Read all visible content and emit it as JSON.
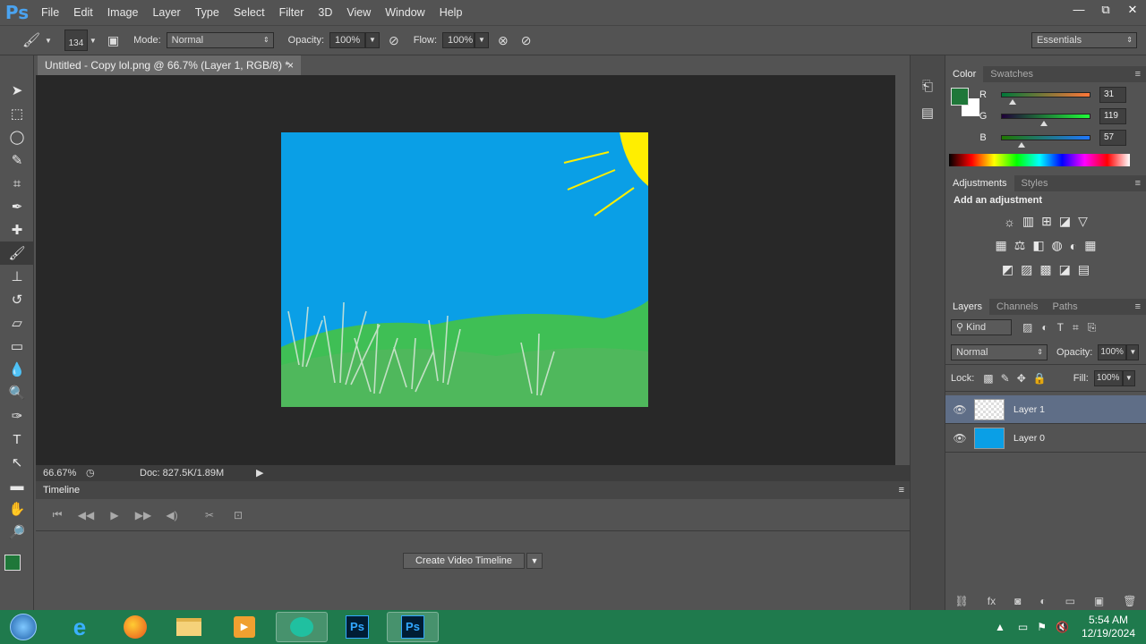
{
  "app": {
    "logo": "Ps"
  },
  "menu": [
    "File",
    "Edit",
    "Image",
    "Layer",
    "Type",
    "Select",
    "Filter",
    "3D",
    "View",
    "Window",
    "Help"
  ],
  "window_controls": {
    "minimize": "—",
    "restore": "⧉",
    "close": "✕"
  },
  "options": {
    "brush_size": "134",
    "mode_label": "Mode:",
    "mode_value": "Normal",
    "opacity_label": "Opacity:",
    "opacity_value": "100%",
    "flow_label": "Flow:",
    "flow_value": "100%",
    "workspace": "Essentials"
  },
  "document": {
    "tab_title": "Untitled - Copy lol.png @ 66.7% (Layer 1, RGB/8) *",
    "tab_close": "×",
    "zoom": "66.67%",
    "doc_info": "Doc: 827.5K/1.89M"
  },
  "timeline": {
    "title": "Timeline",
    "create_button": "Create Video Timeline",
    "controls": [
      "⏮",
      "◀◀",
      "▶",
      "▶▶",
      "◀)",
      "✂",
      "⊡"
    ]
  },
  "color_panel": {
    "tabs": [
      "Color",
      "Swatches"
    ],
    "active_tab": "Color",
    "foreground": "#1f7739",
    "background": "#ffffff",
    "channels": [
      {
        "label": "R",
        "value": "31",
        "fraction": 0.12
      },
      {
        "label": "G",
        "value": "119",
        "fraction": 0.47
      },
      {
        "label": "B",
        "value": "57",
        "fraction": 0.22
      }
    ]
  },
  "adjustments_panel": {
    "tabs": [
      "Adjustments",
      "Styles"
    ],
    "active_tab": "Adjustments",
    "heading": "Add an adjustment",
    "rows": [
      [
        "brightness-contrast-icon",
        "levels-icon",
        "curves-icon",
        "exposure-icon",
        "vibrance-icon"
      ],
      [
        "hue-saturation-icon",
        "color-balance-icon",
        "black-white-icon",
        "photo-filter-icon",
        "channel-mixer-icon",
        "color-lookup-icon"
      ],
      [
        "invert-icon",
        "posterize-icon",
        "threshold-icon",
        "gradient-map-icon",
        "selective-color-icon"
      ]
    ],
    "row_glyphs": [
      [
        "☼",
        "▥",
        "⊞",
        "◪",
        "▽"
      ],
      [
        "▦",
        "⚖",
        "◧",
        "◍",
        "◐",
        "▦"
      ],
      [
        "◩",
        "▨",
        "▩",
        "◪",
        "▤"
      ]
    ]
  },
  "layers_panel": {
    "tabs": [
      "Layers",
      "Channels",
      "Paths"
    ],
    "active_tab": "Layers",
    "filter_kind": "Kind",
    "blend_mode": "Normal",
    "opacity_label": "Opacity:",
    "opacity_value": "100%",
    "lock_label": "Lock:",
    "fill_label": "Fill:",
    "fill_value": "100%",
    "layers": [
      {
        "name": "Layer 1",
        "selected": true,
        "thumb": "transparent"
      },
      {
        "name": "Layer 0",
        "selected": false,
        "thumb": "#0a9fe6"
      }
    ]
  },
  "canvas": {
    "sky_color": "#0a9fe6",
    "sun_color": "#ffee00",
    "grass_color": "#3fbf55"
  },
  "taskbar": {
    "time": "5:54 AM",
    "date": "12/19/2024"
  }
}
